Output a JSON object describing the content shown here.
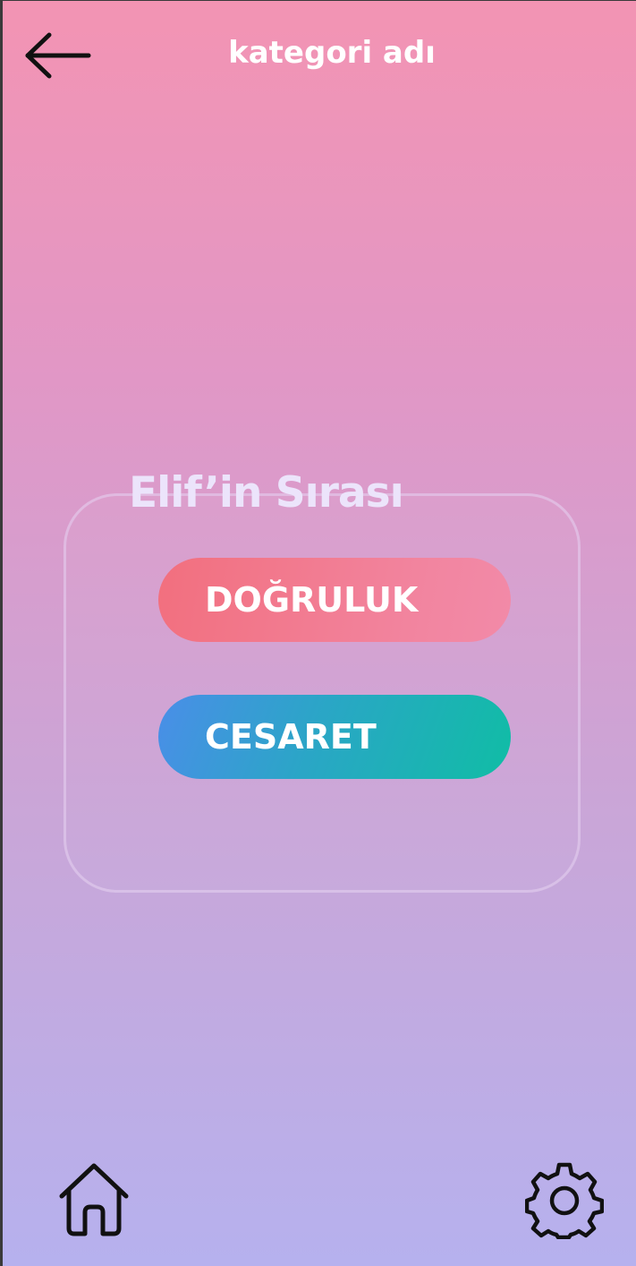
{
  "header": {
    "title": "kategori adı",
    "back_icon": "arrow-left-icon"
  },
  "game": {
    "turn_label": "Elif’in Sırası",
    "truth_label": "DOĞRULUK",
    "dare_label": "CESARET"
  },
  "bottom_nav": {
    "home_icon": "home-icon",
    "settings_icon": "gear-icon"
  },
  "colors": {
    "background_top": "#f394b3",
    "background_bottom": "#b6b1ee",
    "truth_button": "#f26f7e",
    "dare_button_start": "#4a8ee8",
    "dare_button_end": "#10bda5"
  }
}
